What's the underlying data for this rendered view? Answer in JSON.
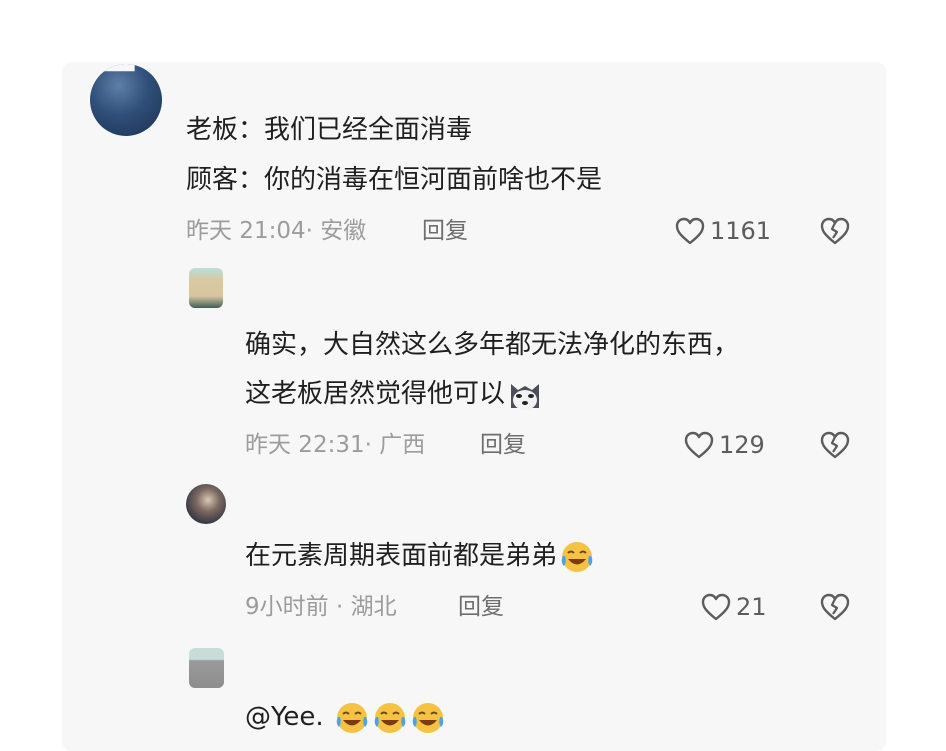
{
  "comments": [
    {
      "line1": "老板：我们已经全面消毒",
      "line2": "顾客：你的消毒在恒河面前啥也不是",
      "meta": "昨天 21:04· 安徽",
      "reply_label": "回复",
      "likes": "1161"
    },
    {
      "line1": "确实，大自然这么多年都无法净化的东西，",
      "line2": "这老板居然觉得他可以",
      "emoji": "husky-doge-emoji",
      "meta": "昨天 22:31· 广西",
      "reply_label": "回复",
      "likes": "129"
    },
    {
      "line1": "在元素周期表面前都是弟弟",
      "emoji": "crying-laughing-emoji",
      "meta": "9小时前 · 湖北",
      "reply_label": "回复",
      "likes": "21"
    },
    {
      "line1": "@Yee.",
      "emoji": "crying-laughing-emoji"
    }
  ],
  "icons": {
    "like": "heart-outline-icon",
    "dislike": "broken-heart-icon"
  }
}
